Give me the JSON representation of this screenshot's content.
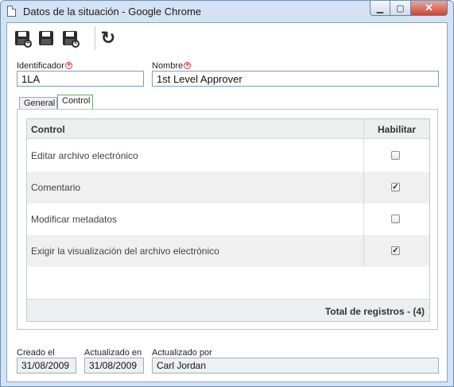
{
  "window": {
    "title": "Datos de la situación - Google Chrome"
  },
  "toolbar": {
    "buttons": [
      {
        "name": "save-new-icon"
      },
      {
        "name": "save-icon"
      },
      {
        "name": "save-close-icon"
      },
      {
        "name": "refresh-icon"
      }
    ]
  },
  "form": {
    "identificador_label": "Identificador",
    "identificador_value": "1LA",
    "nombre_label": "Nombre",
    "nombre_value": "1st Level Approver"
  },
  "tabs": [
    {
      "label": "General",
      "active": false
    },
    {
      "label": "Control",
      "active": true
    }
  ],
  "grid": {
    "headers": {
      "control": "Control",
      "habilitar": "Habilitar"
    },
    "rows": [
      {
        "label": "Editar archivo electrónico",
        "checked": false
      },
      {
        "label": "Comentario",
        "checked": true
      },
      {
        "label": "Modificar metadatos",
        "checked": false
      },
      {
        "label": "Exigir la visualización del archivo electrónico",
        "checked": true
      }
    ],
    "footer": "Total de registros  - (4)"
  },
  "footer": {
    "creado_label": "Creado el",
    "creado_value": "31/08/2009",
    "actualizado_en_label": "Actualizado en",
    "actualizado_en_value": "31/08/2009",
    "actualizado_por_label": "Actualizado por",
    "actualizado_por_value": "Carl Jordan"
  }
}
